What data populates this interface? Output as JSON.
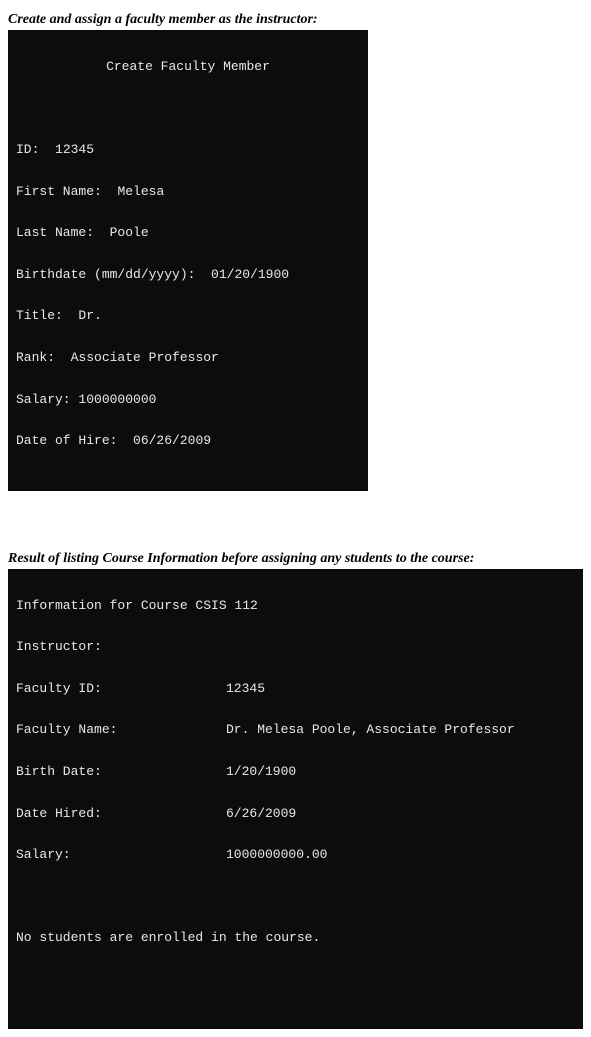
{
  "caption1": "Create and assign a faculty member as the instructor:",
  "terminal1": {
    "title": "Create Faculty Member",
    "fields": {
      "id_label": "ID:",
      "id_value": "12345",
      "first_name_label": "First Name:",
      "first_name_value": "Melesa",
      "last_name_label": "Last Name:",
      "last_name_value": "Poole",
      "birthdate_label": "Birthdate (mm/dd/yyyy):",
      "birthdate_value": "01/20/1900",
      "title_label": "Title:",
      "title_value": "Dr.",
      "rank_label": "Rank:",
      "rank_value": "Associate Professor",
      "salary_label": "Salary:",
      "salary_value": "1000000000",
      "hire_label": "Date of Hire:",
      "hire_value": "06/26/2009"
    }
  },
  "caption2": "Result of listing Course Information before assigning any students to the course:",
  "terminal2": {
    "header": "Information for Course CSIS 112",
    "instructor_label": "Instructor:",
    "rows": {
      "faculty_id_label": "Faculty ID:",
      "faculty_id_value": "12345",
      "faculty_name_label": "Faculty Name:",
      "faculty_name_value": "Dr. Melesa Poole, Associate Professor",
      "birth_date_label": "Birth Date:",
      "birth_date_value": "1/20/1900",
      "date_hired_label": "Date Hired:",
      "date_hired_value": "6/26/2009",
      "salary_label": "Salary:",
      "salary_value": "1000000000.00"
    },
    "footer": "No students are enrolled in the course."
  }
}
